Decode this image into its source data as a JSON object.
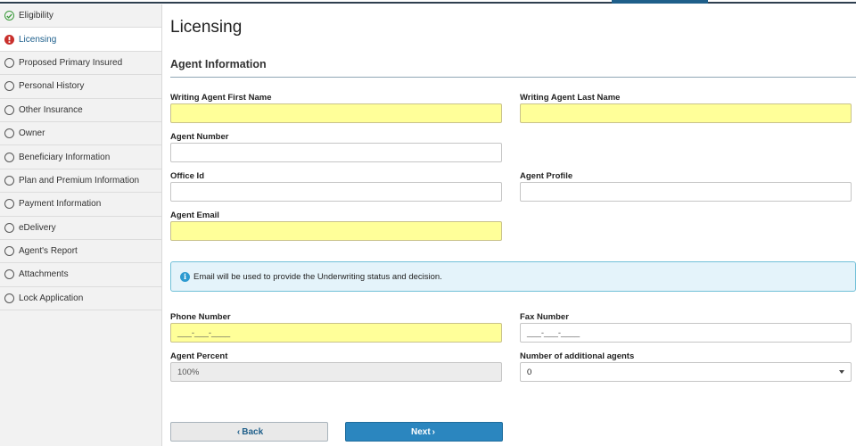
{
  "sidebar": {
    "items": [
      {
        "label": "Eligibility",
        "status": "done"
      },
      {
        "label": "Licensing",
        "status": "error"
      },
      {
        "label": "Proposed Primary Insured",
        "status": "pending"
      },
      {
        "label": "Personal History",
        "status": "pending"
      },
      {
        "label": "Other Insurance",
        "status": "pending"
      },
      {
        "label": "Owner",
        "status": "pending"
      },
      {
        "label": "Beneficiary Information",
        "status": "pending"
      },
      {
        "label": "Plan and Premium Information",
        "status": "pending"
      },
      {
        "label": "Payment Information",
        "status": "pending"
      },
      {
        "label": "eDelivery",
        "status": "pending"
      },
      {
        "label": "Agent's Report",
        "status": "pending"
      },
      {
        "label": "Attachments",
        "status": "pending"
      },
      {
        "label": "Lock Application",
        "status": "pending"
      }
    ]
  },
  "page": {
    "title": "Licensing",
    "section": "Agent Information"
  },
  "form": {
    "first_name": {
      "label": "Writing Agent First Name",
      "value": ""
    },
    "last_name": {
      "label": "Writing Agent Last Name",
      "value": ""
    },
    "agent_number": {
      "label": "Agent Number",
      "value": ""
    },
    "office_id": {
      "label": "Office Id",
      "value": ""
    },
    "agent_profile": {
      "label": "Agent Profile",
      "value": ""
    },
    "agent_email": {
      "label": "Agent Email",
      "value": ""
    },
    "info_text": "Email will be used to provide the Underwriting status and decision.",
    "phone": {
      "label": "Phone Number",
      "mask": "___-___-____"
    },
    "fax": {
      "label": "Fax Number",
      "mask": "___-___-____"
    },
    "agent_percent": {
      "label": "Agent Percent",
      "value": "100%"
    },
    "additional_agents": {
      "label": "Number of additional agents",
      "value": "0"
    }
  },
  "buttons": {
    "back": "Back",
    "next": "Next"
  },
  "colors": {
    "required_field": "#ffff99",
    "accent": "#2b86bf",
    "info_bg": "#e4f3fa",
    "error": "#c9302c",
    "success": "#3a9a3a"
  }
}
